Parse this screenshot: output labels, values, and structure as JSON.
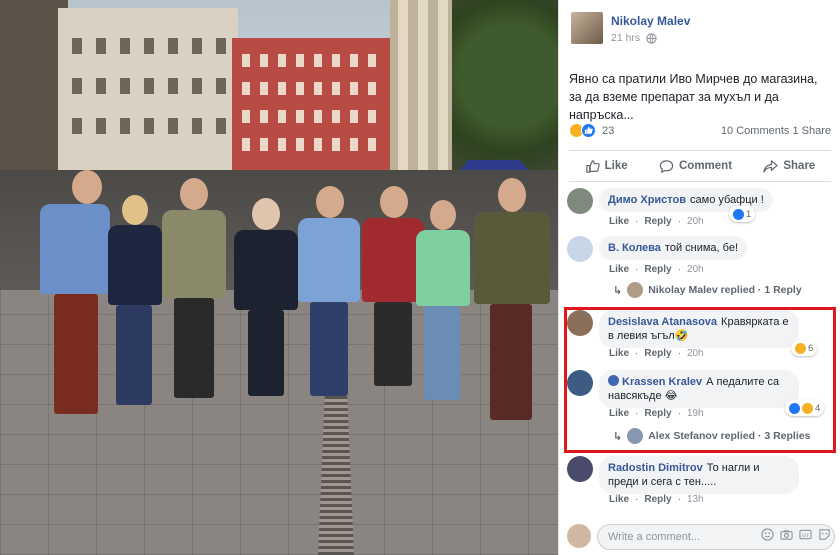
{
  "post": {
    "author": "Nikolay Malev",
    "time": "21 hrs",
    "text": "Явно са пратили Иво Мирчев до магазина, за да вземе препарат за мухъл и да напръска...",
    "reactions_count": "23",
    "comments_shares": "10 Comments  1 Share"
  },
  "actions": {
    "like": "Like",
    "comment": "Comment",
    "share": "Share"
  },
  "comments": [
    {
      "name": "Димо Христов",
      "text": "само убафци !",
      "like": "Like",
      "reply": "Reply",
      "time": "20h",
      "react_count": "1"
    },
    {
      "name": "В. Колева",
      "text": "той снима, бе!",
      "like": "Like",
      "reply": "Reply",
      "time": "20h",
      "replies_label": "Nikolay Malev replied · 1 Reply"
    },
    {
      "name": "Desislava Atanasova",
      "text": "Кравярката е в левия ъгъл🤣",
      "like": "Like",
      "reply": "Reply",
      "time": "20h",
      "react_count": "6"
    },
    {
      "name": "Krassen Kralev",
      "text": "А педалите са навсякъде 😂",
      "like": "Like",
      "reply": "Reply",
      "time": "19h",
      "react_count": "4",
      "replies_label": "Alex Stefanov replied · 3 Replies"
    },
    {
      "name": "Radostin Dimitrov",
      "text": "То нагли и преди и сега с тен.....",
      "like": "Like",
      "reply": "Reply",
      "time": "13h"
    }
  ],
  "composer": {
    "placeholder": "Write a comment..."
  },
  "colors": {
    "link_blue": "#365899",
    "highlight_red": "#e0171c",
    "like_blue": "#2078f4",
    "haha_yellow": "#f7b125"
  },
  "icons": [
    "globe-icon",
    "like-icon",
    "comment-icon",
    "share-icon",
    "verified-badge-icon",
    "reply-arrow-icon",
    "emoji-icon",
    "camera-icon",
    "gif-icon",
    "sticker-icon"
  ]
}
